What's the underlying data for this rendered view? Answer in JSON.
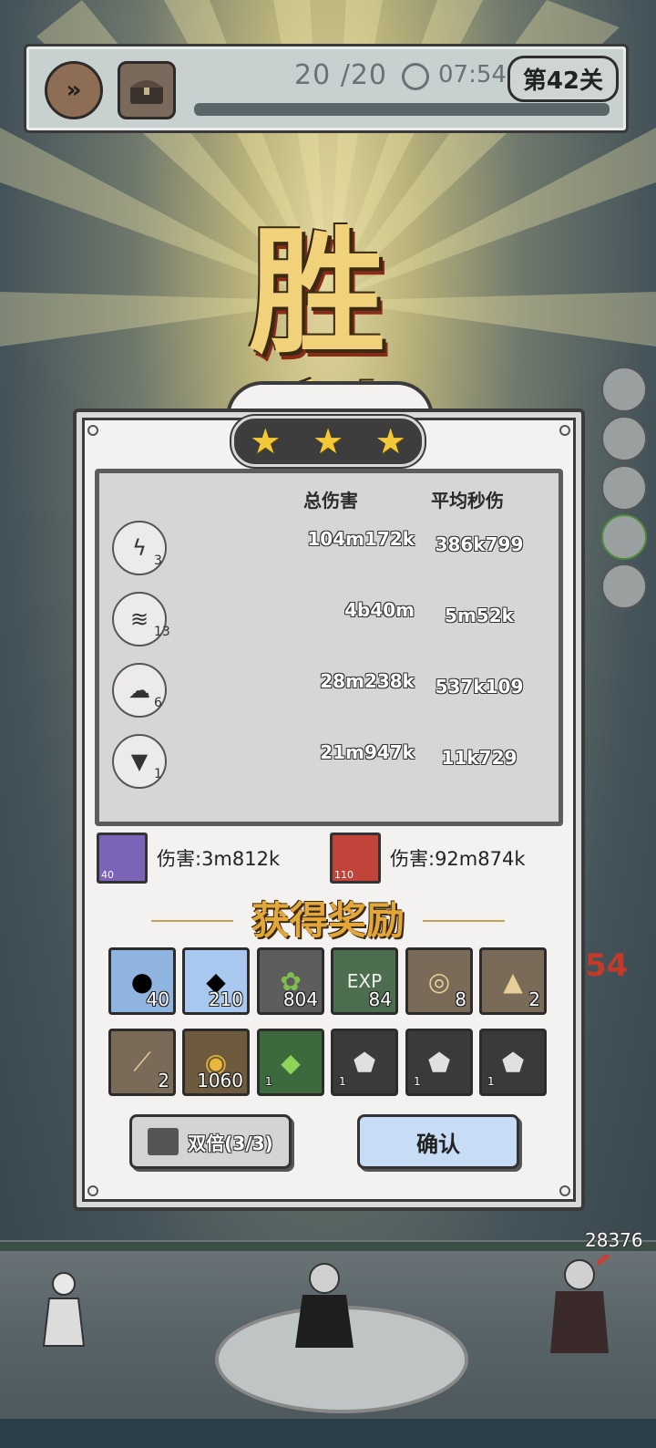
{
  "hud": {
    "wave_progress": "20 /20",
    "timer": "07:54",
    "level": "第42关"
  },
  "victory_title": "胜利",
  "stars": 3,
  "stats": {
    "header_total": "总伤害",
    "header_dps": "平均秒伤",
    "rows": [
      {
        "icon": "lightning-icon",
        "level": "3",
        "total": "104m172k",
        "dps": "386k799"
      },
      {
        "icon": "chain-lightning-icon",
        "level": "13",
        "total": "4b40m",
        "dps": "5m52k"
      },
      {
        "icon": "storm-icon",
        "level": "6",
        "total": "28m238k",
        "dps": "537k109"
      },
      {
        "icon": "drill-icon",
        "level": "1",
        "total": "21m947k",
        "dps": "11k729"
      }
    ]
  },
  "heroes": [
    {
      "portrait": "hero-blue-portrait",
      "level": "40",
      "text": "伤害:3m812k"
    },
    {
      "portrait": "hero-red-portrait",
      "level": "110",
      "text": "伤害:92m874k"
    }
  ],
  "reward_title": "获得奖励",
  "rewards": [
    {
      "name": "bomb-gem-icon",
      "qty": "40"
    },
    {
      "name": "crystal-gem-icon",
      "qty": "210"
    },
    {
      "name": "leaf-orb-icon",
      "qty": "804"
    },
    {
      "name": "exp-orb-icon",
      "qty": "84"
    },
    {
      "name": "ring-scroll-icon",
      "qty": "8"
    },
    {
      "name": "hat-scroll-icon",
      "qty": "2"
    },
    {
      "name": "staff-scroll-icon",
      "qty": "2"
    },
    {
      "name": "gold-coin-icon",
      "qty": "1060"
    },
    {
      "name": "green-shard-icon",
      "qty": "1"
    },
    {
      "name": "ore-armor-icon",
      "qty": "1"
    },
    {
      "name": "ore-boot-icon",
      "qty": "1"
    },
    {
      "name": "ore-ring-icon",
      "qty": "1"
    }
  ],
  "buttons": {
    "double": "双倍(3/3)",
    "confirm": "确认"
  },
  "scene": {
    "enemy_hp": "28376",
    "floating_damage": "54"
  },
  "colors": {
    "gold": "#f1d27a",
    "star": "#f3c93a",
    "confirm_bg": "#c7dcf5",
    "reward_title": "#e3a63a"
  }
}
